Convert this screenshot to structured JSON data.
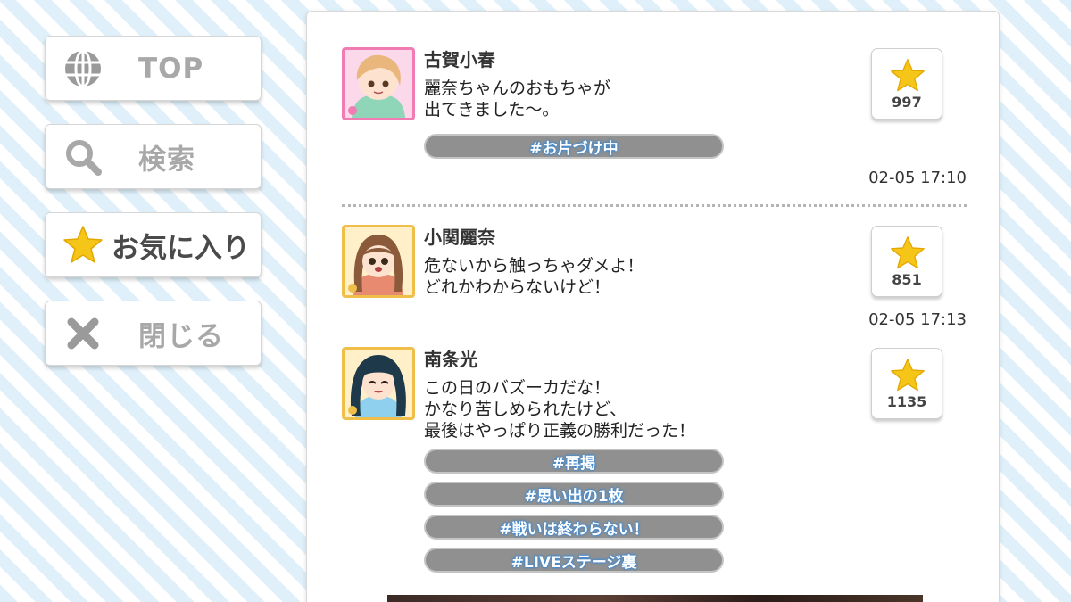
{
  "menu": {
    "items": [
      {
        "label": "TOP",
        "icon": "globe-icon"
      },
      {
        "label": "検索",
        "icon": "search-icon"
      },
      {
        "label": "お気に入り",
        "icon": "star-icon"
      },
      {
        "label": "閉じる",
        "icon": "close-icon"
      }
    ]
  },
  "colors": {
    "star": "#f5c518",
    "tag_fill": "#909090",
    "tag_glow": "#3a8ad8",
    "pink_frame": "#f07cb3",
    "gold_frame": "#f0bf4a"
  },
  "posts": [
    {
      "name": "古賀小春",
      "text": "麗奈ちゃんのおもちゃが\n出てきました～。",
      "tags": [
        "#お片づけ中"
      ],
      "likes": "997",
      "time": "02-05 17:10"
    },
    {
      "name": "小関麗奈",
      "text": "危ないから触っちゃダメよ！\nどれかわからないけど！",
      "tags": [],
      "likes": "851",
      "time": "02-05 17:13"
    },
    {
      "name": "南条光",
      "text": "この日のバズーカだな！\nかなり苦しめられたけど、\n最後はやっぱり正義の勝利だった！",
      "tags": [
        "#再掲",
        "#思い出の1枚",
        "#戦いは終わらない！",
        "#LIVEステージ裏"
      ],
      "likes": "1135",
      "time": ""
    }
  ]
}
